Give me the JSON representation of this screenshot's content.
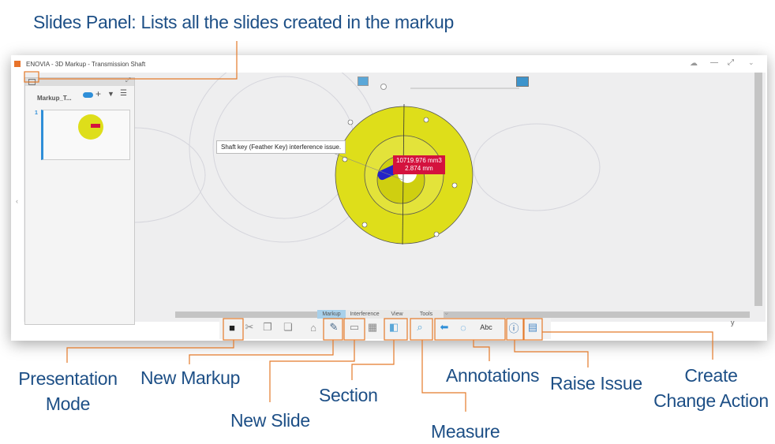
{
  "callouts": {
    "slides_panel": "Slides Panel: Lists all the slides created in the markup",
    "presentation_mode": "Presentation Mode",
    "new_markup": "New Markup",
    "new_slide": "New Slide",
    "section": "Section",
    "measure": "Measure",
    "annotations": "Annotations",
    "raise_issue": "Raise Issue",
    "create_change_action": "Create Change Action"
  },
  "window": {
    "title": "ENOVIA - 3D Markup - Transmission Shaft"
  },
  "slides_panel": {
    "markup_name": "Markup_T...",
    "slides": [
      {
        "number": "1"
      }
    ]
  },
  "viewer": {
    "annotation_text": "Shaft key (Feather Key) interference issue.",
    "measure_volume": "10719.976 mm3",
    "measure_distance": "2.874 mm",
    "axis_label": "y"
  },
  "toolbar": {
    "tabs": [
      "Markup",
      "Interference",
      "View",
      "Tools"
    ],
    "active_tab": "Markup",
    "annotation_text_tool": "Abc"
  },
  "colors": {
    "callout": "#1d4f86",
    "highlight": "#e47a2a",
    "part": "#dede1a",
    "measure_tag": "#d4123e",
    "accent": "#2f8fd8"
  }
}
